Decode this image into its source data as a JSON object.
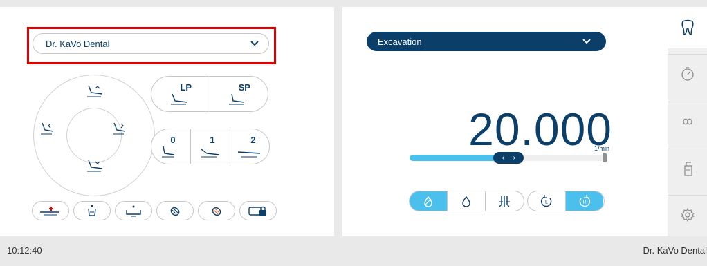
{
  "left": {
    "profile_select": {
      "value": "Dr. KaVo Dental"
    },
    "program_buttons": {
      "lp_label": "LP",
      "sp_label": "SP",
      "mem0_label": "0",
      "mem1_label": "1",
      "mem2_label": "2"
    }
  },
  "right": {
    "mode_select": {
      "value": "Excavation"
    },
    "speed": {
      "value": "20.000",
      "unit": "1/min",
      "fraction": 0.48
    }
  },
  "status": {
    "time": "10:12:40",
    "user": "Dr. KaVo Dental"
  },
  "colors": {
    "navy": "#0c3e6a",
    "accent": "#4cc0ec",
    "highlight": "#e00000"
  }
}
